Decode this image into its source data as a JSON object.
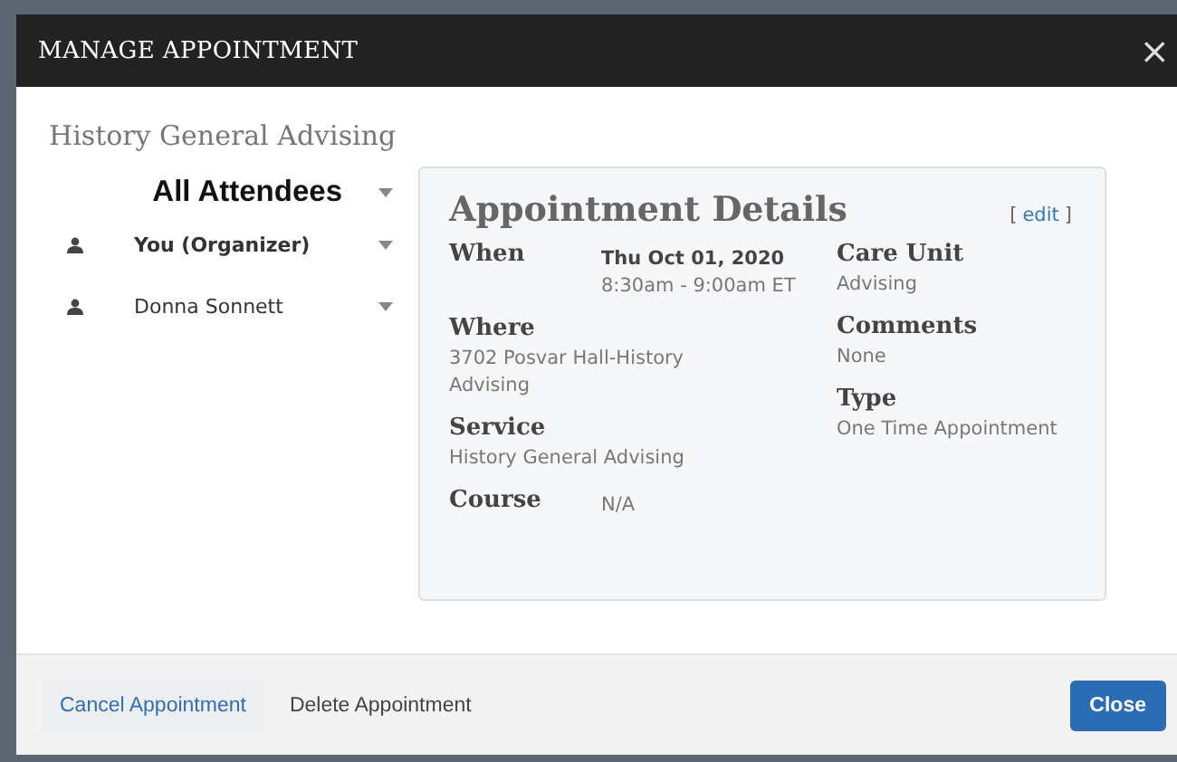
{
  "dialog": {
    "title": "MANAGE APPOINTMENT",
    "close_icon": "×",
    "subtitle": "History General Advising"
  },
  "attendees": [
    {
      "kind": "all",
      "name": "All Attendees"
    },
    {
      "kind": "organizer",
      "name": "You (Organizer)"
    },
    {
      "kind": "person",
      "name": "Donna Sonnett"
    }
  ],
  "details": {
    "title": "Appointment Details",
    "edit_open": "[",
    "edit_link": "edit",
    "edit_close": "]",
    "left": [
      {
        "label": "When",
        "kind": "inline",
        "lines": [
          {
            "text": "Thu Oct 01, 2020",
            "bold": true
          },
          {
            "text": "8:30am - 9:00am ET",
            "bold": false
          }
        ]
      },
      {
        "label": "Where",
        "kind": "stacked",
        "lines": [
          {
            "text": "3702 Posvar Hall-History Advising",
            "bold": false
          }
        ]
      },
      {
        "label": "Service",
        "kind": "stacked",
        "lines": [
          {
            "text": "History General Advising",
            "bold": false
          }
        ]
      },
      {
        "label": "Course",
        "kind": "inline",
        "lines": [
          {
            "text": "N/A",
            "bold": false
          }
        ]
      }
    ],
    "right": [
      {
        "label": "Care Unit",
        "kind": "stacked",
        "lines": [
          {
            "text": "Advising",
            "bold": false
          }
        ]
      },
      {
        "label": "Comments",
        "kind": "stacked",
        "lines": [
          {
            "text": "None",
            "bold": false
          }
        ]
      },
      {
        "label": "Type",
        "kind": "stacked",
        "lines": [
          {
            "text": "One Time Appointment",
            "bold": false
          }
        ]
      }
    ]
  },
  "footer": {
    "buttons": [
      {
        "kind": "primary-link",
        "label": "Cancel Appointment"
      },
      {
        "kind": "link",
        "label": "Delete Appointment"
      },
      {
        "kind": "primary",
        "label": "Close"
      }
    ]
  }
}
